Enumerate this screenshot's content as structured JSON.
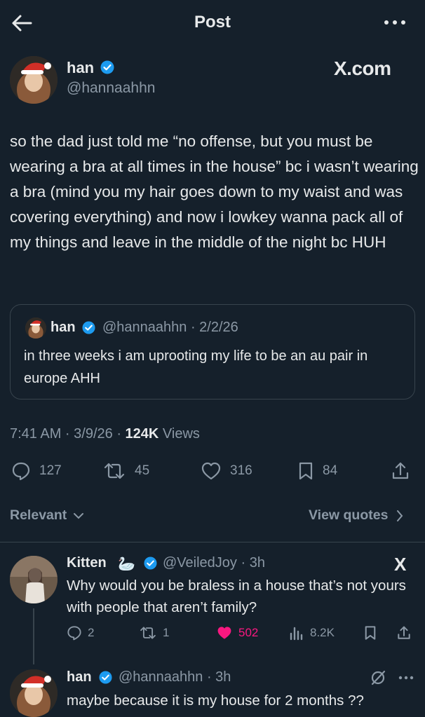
{
  "header": {
    "title": "Post",
    "back_icon": "arrow-left-icon",
    "more_icon": "more-horizontal-icon"
  },
  "post": {
    "author_name": "han",
    "author_handle": "@hannaahhn",
    "watermark": "X.com",
    "text": "so the dad just told me “no offense, but you must be wearing a bra at all times in the house” bc i wasn’t wearing a bra (mind you my hair goes down to my waist and was covering everything) and now i lowkey wanna pack all of my things and leave in the middle of the night bc HUH",
    "quote": {
      "author_name": "han",
      "author_handle": "@hannaahhn · 2/2/26",
      "text": "in three weeks i am uprooting my life to be an au pair in europe AHH"
    },
    "time": "7:41 AM · 3/9/26 · ",
    "views_count": "124K",
    "views_label": " Views",
    "stats": {
      "replies": "127",
      "reposts": "45",
      "likes": "316",
      "bookmarks": "84"
    }
  },
  "sort": {
    "relevant_label": "Relevant",
    "view_quotes_label": "View quotes"
  },
  "replies": [
    {
      "name": "Kitten",
      "emoji": "🦢",
      "handle": "@VeiledJoy · 3h",
      "badge": "X",
      "text": "Why would you be braless in a house that’s not yours with people that aren’t family?",
      "stats": {
        "replies": "2",
        "reposts": "1",
        "likes": "502",
        "views": "8.2K"
      }
    },
    {
      "name": "han",
      "handle": "@hannaahhn · 3h",
      "text": "maybe because it is my house for 2 months ??"
    }
  ],
  "colors": {
    "background": "#15202b",
    "text": "#e7e9ea",
    "muted": "#8b98a5",
    "verified": "#1d9bf0",
    "liked": "#f91880",
    "border": "#38444d"
  }
}
